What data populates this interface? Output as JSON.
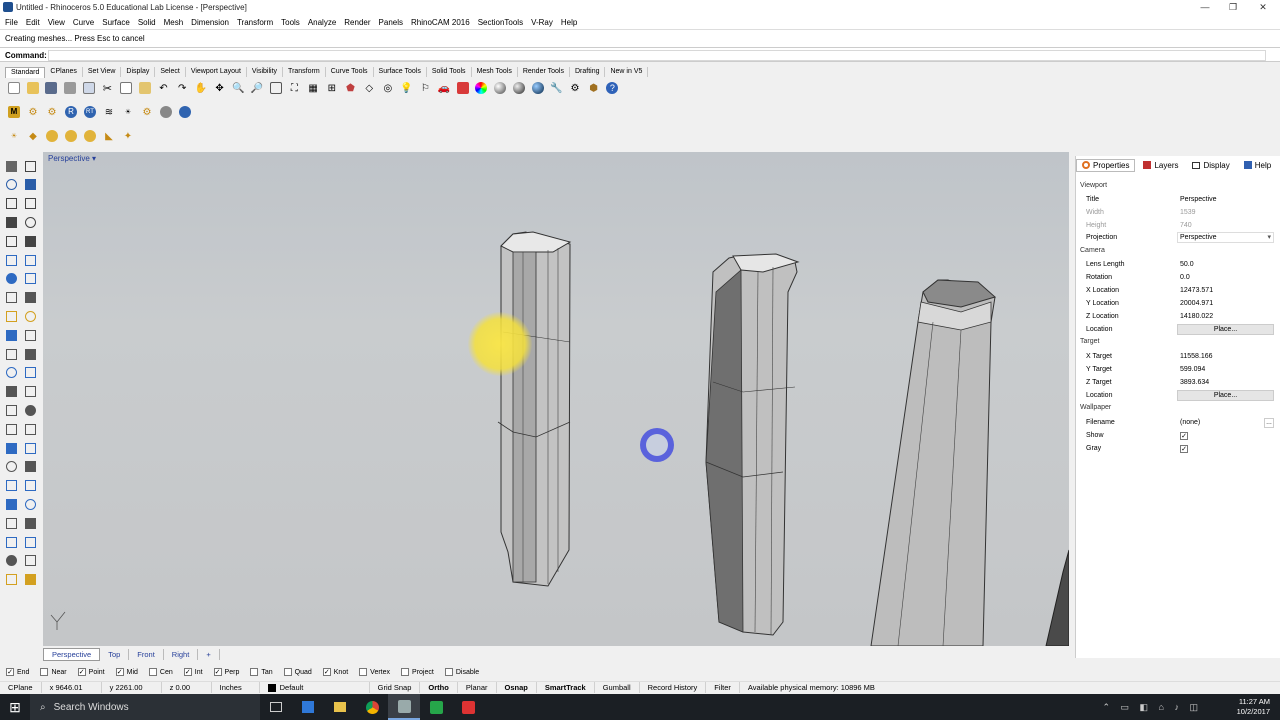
{
  "window": {
    "title": "Untitled - Rhinoceros 5.0 Educational Lab License - [Perspective]",
    "controls": {
      "minimize": "—",
      "restore": "❐",
      "close": "✕"
    }
  },
  "menu": [
    "File",
    "Edit",
    "View",
    "Curve",
    "Surface",
    "Solid",
    "Mesh",
    "Dimension",
    "Transform",
    "Tools",
    "Analyze",
    "Render",
    "Panels",
    "RhinoCAM 2016",
    "SectionTools",
    "V-Ray",
    "Help"
  ],
  "command_history": "Creating meshes... Press Esc to cancel",
  "command_label": "Command:",
  "toolbar_tabs": [
    "Standard",
    "CPlanes",
    "Set View",
    "Display",
    "Select",
    "Viewport Layout",
    "Visibility",
    "Transform",
    "Curve Tools",
    "Surface Tools",
    "Solid Tools",
    "Mesh Tools",
    "Render Tools",
    "Drafting",
    "New in V5"
  ],
  "viewport": {
    "title": "Perspective",
    "dropdown_icon": "▾"
  },
  "view_tabs": [
    "Perspective",
    "Top",
    "Front",
    "Right",
    "+"
  ],
  "osnaps": [
    {
      "label": "End",
      "checked": true
    },
    {
      "label": "Near",
      "checked": false
    },
    {
      "label": "Point",
      "checked": true
    },
    {
      "label": "Mid",
      "checked": true
    },
    {
      "label": "Cen",
      "checked": false
    },
    {
      "label": "Int",
      "checked": true
    },
    {
      "label": "Perp",
      "checked": true
    },
    {
      "label": "Tan",
      "checked": false
    },
    {
      "label": "Quad",
      "checked": false
    },
    {
      "label": "Knot",
      "checked": true
    },
    {
      "label": "Vertex",
      "checked": false
    },
    {
      "label": "Project",
      "checked": false
    },
    {
      "label": "Disable",
      "checked": false
    }
  ],
  "status": {
    "cplane": "CPlane",
    "x": "x 9646.01",
    "y": "y 2261.00",
    "z": "z 0.00",
    "units": "Inches",
    "layer": "Default",
    "grid_snap": "Grid Snap",
    "ortho": "Ortho",
    "planar": "Planar",
    "osnap": "Osnap",
    "smarttrack": "SmartTrack",
    "gumball": "Gumball",
    "record_history": "Record History",
    "filter": "Filter",
    "memory": "Available physical memory: 10896 MB"
  },
  "taskbar": {
    "search": "Search Windows",
    "time": "11:27 AM",
    "date": "10/2/2017"
  },
  "panel": {
    "tabs": [
      "Properties",
      "Layers",
      "Display",
      "Help"
    ],
    "sections": {
      "viewport": "Viewport",
      "camera": "Camera",
      "target": "Target",
      "wallpaper": "Wallpaper"
    },
    "title_label": "Title",
    "title_value": "Perspective",
    "width_label": "Width",
    "width_value": "1539",
    "height_label": "Height",
    "height_value": "740",
    "projection_label": "Projection",
    "projection_value": "Perspective",
    "lens_label": "Lens Length",
    "lens_value": "50.0",
    "rotation_label": "Rotation",
    "rotation_value": "0.0",
    "xloc_label": "X Location",
    "xloc_value": "12473.571",
    "yloc_label": "Y Location",
    "yloc_value": "20004.971",
    "zloc_label": "Z Location",
    "zloc_value": "14180.022",
    "location_label": "Location",
    "place_button": "Place...",
    "xtgt_label": "X Target",
    "xtgt_value": "11558.166",
    "ytgt_label": "Y Target",
    "ytgt_value": "599.094",
    "ztgt_label": "Z Target",
    "ztgt_value": "3893.634",
    "tlocation_label": "Location",
    "tplace_button": "Place...",
    "filename_label": "Filename",
    "filename_value": "(none)",
    "show_label": "Show",
    "gray_label": "Gray"
  }
}
